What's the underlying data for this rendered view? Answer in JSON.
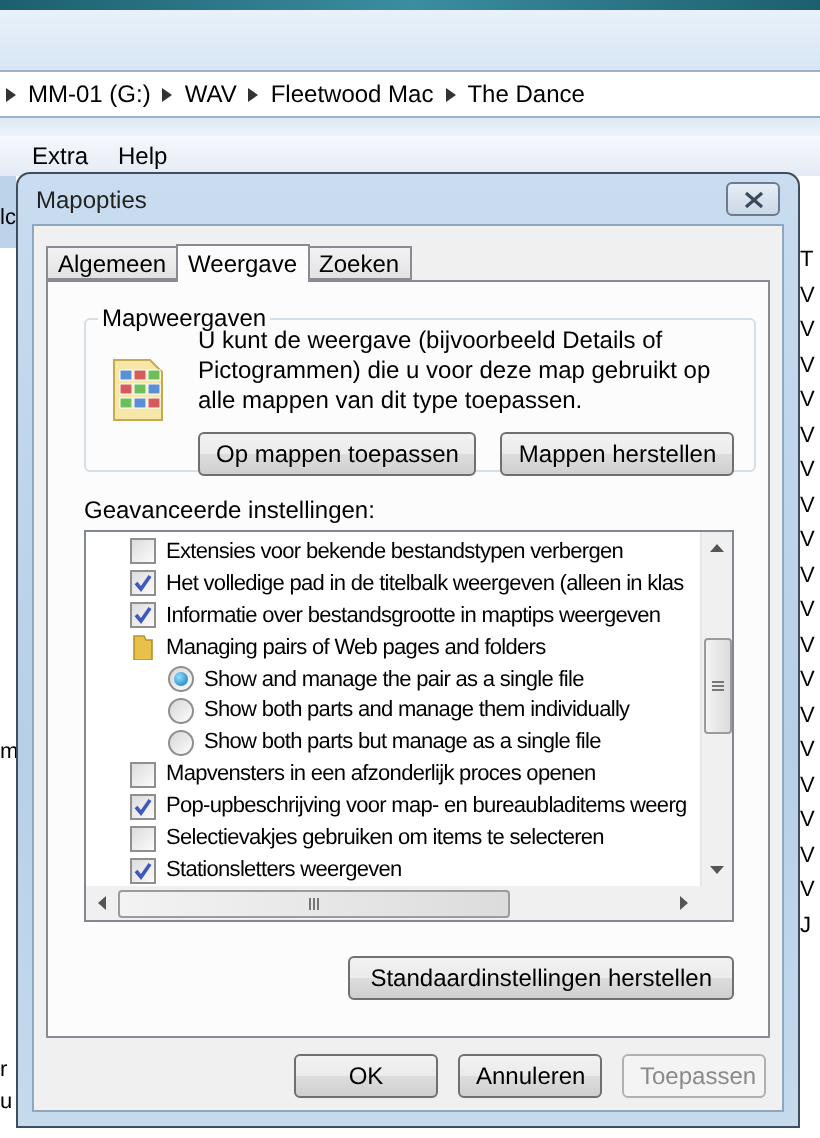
{
  "background": {
    "breadcrumbs": [
      "MM-01 (G:)",
      "WAV",
      "Fleetwood Mac",
      "The Dance"
    ],
    "menu": [
      "Extra",
      "Help"
    ],
    "left_edge": [
      "lc",
      "m",
      "r",
      "u"
    ],
    "right_edge": [
      "T",
      "V",
      "V",
      "V",
      "V",
      "V",
      "V",
      "V",
      "V",
      "V",
      "V",
      "V",
      "V",
      "V",
      "V",
      "V",
      "V",
      "V",
      "V",
      "J"
    ]
  },
  "dialog": {
    "title": "Mapopties",
    "tabs": [
      {
        "label": "Algemeen",
        "selected": false
      },
      {
        "label": "Weergave",
        "selected": true
      },
      {
        "label": "Zoeken",
        "selected": false
      }
    ],
    "folder_views": {
      "title": "Mapweergaven",
      "description": "U kunt de weergave (bijvoorbeeld Details of Pictogrammen) die u voor deze map gebruikt op alle mappen van dit type toepassen.",
      "buttons": [
        "Op mappen toepassen",
        "Mappen herstellen"
      ]
    },
    "advanced": {
      "label": "Geavanceerde instellingen:",
      "items": [
        {
          "kind": "checkbox",
          "label": "Extensies voor bekende bestandstypen verbergen",
          "checked": false
        },
        {
          "kind": "checkbox",
          "label": "Het volledige pad in de titelbalk weergeven (alleen in klas",
          "checked": true
        },
        {
          "kind": "checkbox",
          "label": "Informatie over bestandsgrootte in maptips weergeven",
          "checked": true
        },
        {
          "kind": "folder",
          "label": "Managing pairs of Web pages and folders",
          "children": [
            {
              "kind": "radio",
              "label": "Show and manage the pair as a single file",
              "selected": true
            },
            {
              "kind": "radio",
              "label": "Show both parts and manage them individually",
              "selected": false
            },
            {
              "kind": "radio",
              "label": "Show both parts but manage as a single file",
              "selected": false
            }
          ]
        },
        {
          "kind": "checkbox",
          "label": "Mapvensters in een afzonderlijk proces openen",
          "checked": false
        },
        {
          "kind": "checkbox",
          "label": "Pop-upbeschrijving voor map- en bureaubladitems weerg",
          "checked": true
        },
        {
          "kind": "checkbox",
          "label": "Selectievakjes gebruiken om items te selecteren",
          "checked": false
        },
        {
          "kind": "checkbox",
          "label": "Stationsletters weergeven",
          "checked": true
        }
      ]
    },
    "restore_button": "Standaardinstellingen herstellen",
    "buttons": [
      {
        "label": "OK",
        "disabled": false
      },
      {
        "label": "Annuleren",
        "disabled": false
      },
      {
        "label": "Toepassen",
        "disabled": true
      }
    ]
  }
}
